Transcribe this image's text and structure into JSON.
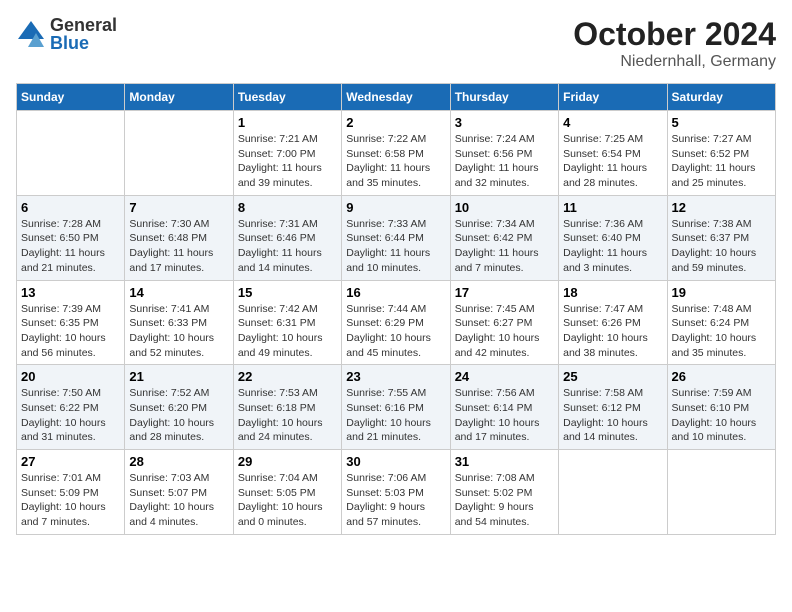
{
  "header": {
    "logo_general": "General",
    "logo_blue": "Blue",
    "month_title": "October 2024",
    "location": "Niedernhall, Germany"
  },
  "weekdays": [
    "Sunday",
    "Monday",
    "Tuesday",
    "Wednesday",
    "Thursday",
    "Friday",
    "Saturday"
  ],
  "weeks": [
    [
      {
        "day": "",
        "info": ""
      },
      {
        "day": "",
        "info": ""
      },
      {
        "day": "1",
        "info": "Sunrise: 7:21 AM\nSunset: 7:00 PM\nDaylight: 11 hours\nand 39 minutes."
      },
      {
        "day": "2",
        "info": "Sunrise: 7:22 AM\nSunset: 6:58 PM\nDaylight: 11 hours\nand 35 minutes."
      },
      {
        "day": "3",
        "info": "Sunrise: 7:24 AM\nSunset: 6:56 PM\nDaylight: 11 hours\nand 32 minutes."
      },
      {
        "day": "4",
        "info": "Sunrise: 7:25 AM\nSunset: 6:54 PM\nDaylight: 11 hours\nand 28 minutes."
      },
      {
        "day": "5",
        "info": "Sunrise: 7:27 AM\nSunset: 6:52 PM\nDaylight: 11 hours\nand 25 minutes."
      }
    ],
    [
      {
        "day": "6",
        "info": "Sunrise: 7:28 AM\nSunset: 6:50 PM\nDaylight: 11 hours\nand 21 minutes."
      },
      {
        "day": "7",
        "info": "Sunrise: 7:30 AM\nSunset: 6:48 PM\nDaylight: 11 hours\nand 17 minutes."
      },
      {
        "day": "8",
        "info": "Sunrise: 7:31 AM\nSunset: 6:46 PM\nDaylight: 11 hours\nand 14 minutes."
      },
      {
        "day": "9",
        "info": "Sunrise: 7:33 AM\nSunset: 6:44 PM\nDaylight: 11 hours\nand 10 minutes."
      },
      {
        "day": "10",
        "info": "Sunrise: 7:34 AM\nSunset: 6:42 PM\nDaylight: 11 hours\nand 7 minutes."
      },
      {
        "day": "11",
        "info": "Sunrise: 7:36 AM\nSunset: 6:40 PM\nDaylight: 11 hours\nand 3 minutes."
      },
      {
        "day": "12",
        "info": "Sunrise: 7:38 AM\nSunset: 6:37 PM\nDaylight: 10 hours\nand 59 minutes."
      }
    ],
    [
      {
        "day": "13",
        "info": "Sunrise: 7:39 AM\nSunset: 6:35 PM\nDaylight: 10 hours\nand 56 minutes."
      },
      {
        "day": "14",
        "info": "Sunrise: 7:41 AM\nSunset: 6:33 PM\nDaylight: 10 hours\nand 52 minutes."
      },
      {
        "day": "15",
        "info": "Sunrise: 7:42 AM\nSunset: 6:31 PM\nDaylight: 10 hours\nand 49 minutes."
      },
      {
        "day": "16",
        "info": "Sunrise: 7:44 AM\nSunset: 6:29 PM\nDaylight: 10 hours\nand 45 minutes."
      },
      {
        "day": "17",
        "info": "Sunrise: 7:45 AM\nSunset: 6:27 PM\nDaylight: 10 hours\nand 42 minutes."
      },
      {
        "day": "18",
        "info": "Sunrise: 7:47 AM\nSunset: 6:26 PM\nDaylight: 10 hours\nand 38 minutes."
      },
      {
        "day": "19",
        "info": "Sunrise: 7:48 AM\nSunset: 6:24 PM\nDaylight: 10 hours\nand 35 minutes."
      }
    ],
    [
      {
        "day": "20",
        "info": "Sunrise: 7:50 AM\nSunset: 6:22 PM\nDaylight: 10 hours\nand 31 minutes."
      },
      {
        "day": "21",
        "info": "Sunrise: 7:52 AM\nSunset: 6:20 PM\nDaylight: 10 hours\nand 28 minutes."
      },
      {
        "day": "22",
        "info": "Sunrise: 7:53 AM\nSunset: 6:18 PM\nDaylight: 10 hours\nand 24 minutes."
      },
      {
        "day": "23",
        "info": "Sunrise: 7:55 AM\nSunset: 6:16 PM\nDaylight: 10 hours\nand 21 minutes."
      },
      {
        "day": "24",
        "info": "Sunrise: 7:56 AM\nSunset: 6:14 PM\nDaylight: 10 hours\nand 17 minutes."
      },
      {
        "day": "25",
        "info": "Sunrise: 7:58 AM\nSunset: 6:12 PM\nDaylight: 10 hours\nand 14 minutes."
      },
      {
        "day": "26",
        "info": "Sunrise: 7:59 AM\nSunset: 6:10 PM\nDaylight: 10 hours\nand 10 minutes."
      }
    ],
    [
      {
        "day": "27",
        "info": "Sunrise: 7:01 AM\nSunset: 5:09 PM\nDaylight: 10 hours\nand 7 minutes."
      },
      {
        "day": "28",
        "info": "Sunrise: 7:03 AM\nSunset: 5:07 PM\nDaylight: 10 hours\nand 4 minutes."
      },
      {
        "day": "29",
        "info": "Sunrise: 7:04 AM\nSunset: 5:05 PM\nDaylight: 10 hours\nand 0 minutes."
      },
      {
        "day": "30",
        "info": "Sunrise: 7:06 AM\nSunset: 5:03 PM\nDaylight: 9 hours\nand 57 minutes."
      },
      {
        "day": "31",
        "info": "Sunrise: 7:08 AM\nSunset: 5:02 PM\nDaylight: 9 hours\nand 54 minutes."
      },
      {
        "day": "",
        "info": ""
      },
      {
        "day": "",
        "info": ""
      }
    ]
  ]
}
